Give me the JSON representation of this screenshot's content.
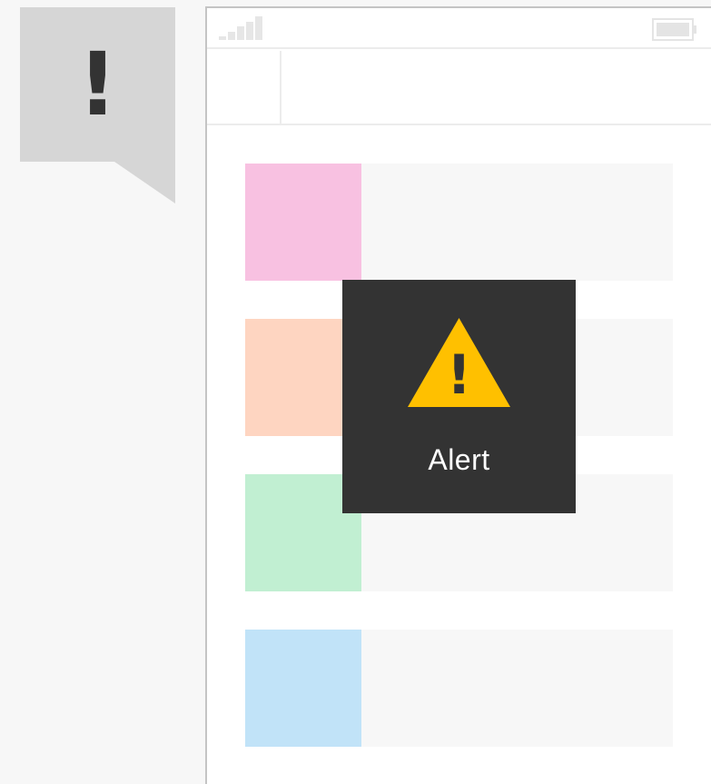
{
  "badge": {
    "symbol": "!",
    "background": "#d6d6d6",
    "icon": "exclamation-bubble-icon"
  },
  "status_bar": {
    "signal_icon": "signal-strength-icon",
    "battery_icon": "battery-icon"
  },
  "nav_bar": {
    "back_icon": "nav-back-placeholder"
  },
  "list": {
    "items": [
      {
        "thumb_color": "#f8c1e1"
      },
      {
        "thumb_color": "#fed5c1"
      },
      {
        "thumb_color": "#c1efd2"
      },
      {
        "thumb_color": "#c1e3f8"
      }
    ]
  },
  "toast": {
    "label": "Alert",
    "icon": "warning-triangle-icon",
    "icon_symbol": "!",
    "background": "#333333",
    "icon_color": "#ffc000"
  }
}
